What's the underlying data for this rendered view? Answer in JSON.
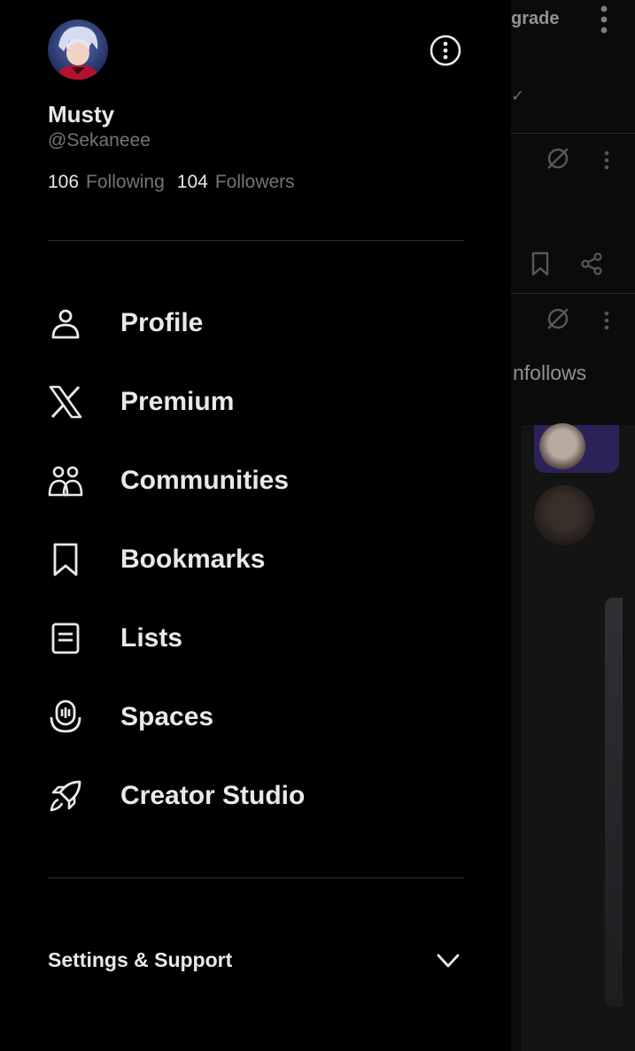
{
  "account": {
    "display_name": "Musty",
    "handle": "@Sekaneee",
    "following_count": "106",
    "following_label": "Following",
    "followers_count": "104",
    "followers_label": "Followers"
  },
  "menu": {
    "items": [
      {
        "label": "Profile",
        "icon": "person-icon"
      },
      {
        "label": "Premium",
        "icon": "x-logo-icon"
      },
      {
        "label": "Communities",
        "icon": "communities-icon"
      },
      {
        "label": "Bookmarks",
        "icon": "bookmark-icon"
      },
      {
        "label": "Lists",
        "icon": "list-icon"
      },
      {
        "label": "Spaces",
        "icon": "spaces-icon"
      },
      {
        "label": "Creator Studio",
        "icon": "rocket-icon"
      }
    ]
  },
  "settings": {
    "label": "Settings & Support",
    "icon": "chevron-down-icon"
  },
  "background": {
    "upgrade_fragment": "grade",
    "check_glyph": "✓",
    "unfollows_fragment": "nfollows"
  },
  "colors": {
    "background": "#000000",
    "primary_text": "#e7e9ea",
    "secondary_text": "#71767b",
    "divider": "#2f3336"
  }
}
